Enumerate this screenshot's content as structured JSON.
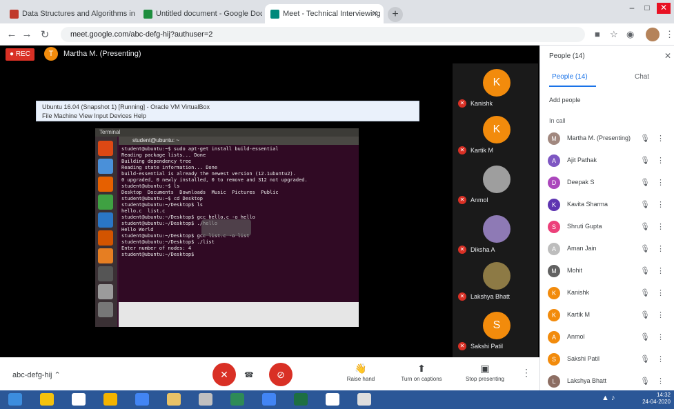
{
  "browser": {
    "tabs": [
      {
        "label": "Data Structures and Algorithms in",
        "favicon_color": "#c0392b"
      },
      {
        "label": "Untitled document - Google Docs",
        "favicon_color": "#1e8e3e"
      },
      {
        "label": "Meet - Technical Interviewing",
        "favicon_color": "#00897b"
      }
    ],
    "new_tab": "+",
    "url": "meet.google.com/abc-defg-hij?authuser=2",
    "window_controls": [
      "–",
      "□",
      "✕"
    ]
  },
  "meet": {
    "recording_label": "REC",
    "presenter_initial": "T",
    "presenter_text": "Martha M. (Presenting)",
    "shared_window": {
      "title": "Ubuntu 16.04 (Snapshot 1) [Running] - Oracle VM VirtualBox",
      "menu": "File  Machine  View  Input  Devices  Help",
      "vm_title": "Terminal",
      "terminal_title": "student@ubuntu: ~",
      "terminal_lines": [
        "student@ubuntu:~$ sudo apt-get install build-essential",
        "Reading package lists... Done",
        "Building dependency tree",
        "Reading state information... Done",
        "build-essential is already the newest version (12.1ubuntu2).",
        "0 upgraded, 0 newly installed, 0 to remove and 312 not upgraded.",
        "student@ubuntu:~$ ls",
        "Desktop  Documents  Downloads  Music  Pictures  Public",
        "student@ubuntu:~$ cd Desktop",
        "student@ubuntu:~/Desktop$ ls",
        "hello.c  list.c",
        "student@ubuntu:~/Desktop$ gcc hello.c -o hello",
        "student@ubuntu:~/Desktop$ ./hello",
        "Hello World",
        "student@ubuntu:~/Desktop$ gcc list.c -o list",
        "student@ubuntu:~/Desktop$ ./list",
        "Enter number of nodes: 4",
        "student@ubuntu:~/Desktop$ "
      ]
    },
    "tiles": [
      {
        "initial": "K",
        "name": "Kanishk",
        "color": "#f28b0c"
      },
      {
        "initial": "K",
        "name": "Kartik M",
        "color": "#f28b0c"
      },
      {
        "initial": "",
        "name": "Anmol",
        "color": "#9e9e9e"
      },
      {
        "initial": "",
        "name": "Diksha A",
        "color": "#8e7ab5"
      },
      {
        "initial": "",
        "name": "Lakshya Bhatt",
        "color": "#8d7a45"
      },
      {
        "initial": "S",
        "name": "Sakshi Patil",
        "color": "#f28b0c"
      }
    ],
    "meeting_code": "abc-defg-hij",
    "bottom_actions": [
      {
        "icon": "👋",
        "label": "Raise hand"
      },
      {
        "icon": "⬆",
        "label": "Turn on captions"
      },
      {
        "icon": "▣",
        "label": "Stop presenting"
      }
    ],
    "more_options": "⋮"
  },
  "people_panel": {
    "title": "People (14)",
    "tabs": [
      "People (14)",
      "Chat"
    ],
    "add_people": "Add people",
    "section": "In call",
    "participants": [
      {
        "name": "Martha M. (Presenting)",
        "color": "#a1887f",
        "initial": "M"
      },
      {
        "name": "Ajit Pathak",
        "color": "#7e57c2",
        "initial": "A"
      },
      {
        "name": "Deepak S",
        "color": "#ab47bc",
        "initial": "D"
      },
      {
        "name": "Kavita Sharma",
        "color": "#5e35b1",
        "initial": "K"
      },
      {
        "name": "Shruti Gupta",
        "color": "#ec407a",
        "initial": "S"
      },
      {
        "name": "Aman Jain",
        "color": "#bdbdbd",
        "initial": "A"
      },
      {
        "name": "Mohit",
        "color": "#616161",
        "initial": "M"
      },
      {
        "name": "Kanishk",
        "color": "#f28b0c",
        "initial": "K"
      },
      {
        "name": "Kartik M",
        "color": "#f28b0c",
        "initial": "K"
      },
      {
        "name": "Anmol",
        "color": "#f28b0c",
        "initial": "A"
      },
      {
        "name": "Sakshi Patil",
        "color": "#f28b0c",
        "initial": "S"
      },
      {
        "name": "Lakshya Bhatt",
        "color": "#8d6e63",
        "initial": "L"
      }
    ]
  },
  "taskbar": {
    "apps": [
      "#3c8dde",
      "#f4c20d",
      "#ffffff",
      "#f4b400",
      "#4285f4",
      "#e8c267",
      "#c0c0c0",
      "#2e8b57",
      "#4285f4",
      "#1d6f42",
      "#ffffff",
      "#dddddd"
    ],
    "tray": "▲ ♪",
    "time": "14:32",
    "date": "24-04-2020"
  }
}
